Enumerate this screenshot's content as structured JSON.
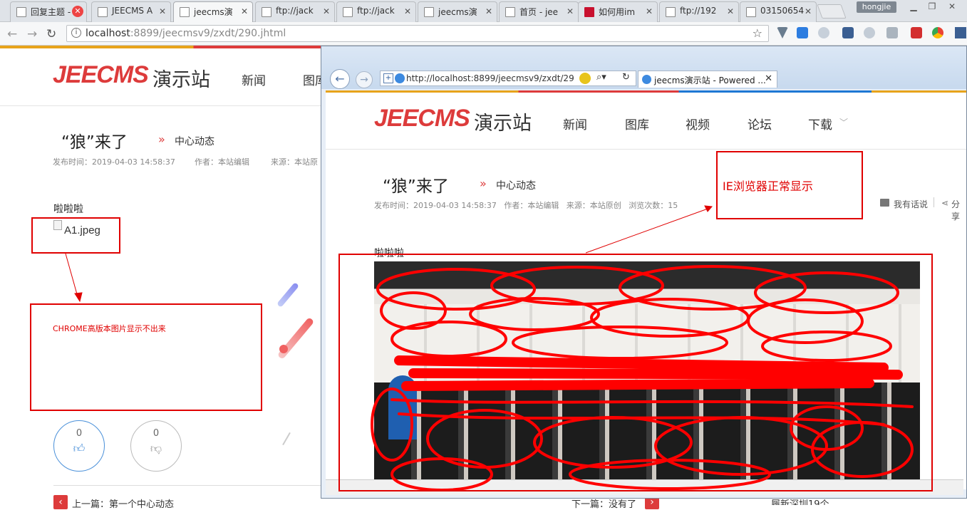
{
  "chrome": {
    "tabs": [
      {
        "title": "回复主题 -"
      },
      {
        "title": "JEECMS A"
      },
      {
        "title": "jeecms演"
      },
      {
        "title": "ftp://jack"
      },
      {
        "title": "ftp://jack"
      },
      {
        "title": "jeecms演"
      },
      {
        "title": "首页 - jee"
      },
      {
        "title": "如何用im"
      },
      {
        "title": "ftp://192"
      },
      {
        "title": "03150654"
      }
    ],
    "user": "hongjie",
    "url_host": "localhost",
    "url_rest": ":8899/jeecmsv9/zxdt/290.jhtml"
  },
  "site": {
    "logo_en": "JEECMS",
    "logo_cn": "演示站",
    "menu": [
      "新闻",
      "图库",
      "视频",
      "论坛",
      "下载"
    ]
  },
  "article": {
    "title": "“狼”来了",
    "category": "中心动态",
    "meta_time": "发布时间：2019-04-03 14:58:37",
    "meta_author": "作者：本站编辑",
    "meta_source_short": "来源：本站原",
    "meta_full": "发布时间：2019-04-03 14:58:37   作者：本站编辑   来源：本站原创   浏览次数：15",
    "body_text": "啦啦啦",
    "broken_image_alt": "A1.jpeg",
    "likes": "0",
    "dislikes": "0",
    "prev": "上一篇：第一个中心动态",
    "next": "下一篇：没有了",
    "comment": "我有话说",
    "share": "分享",
    "cut_bottom_text": "履新深圳19个"
  },
  "annotations": {
    "chrome_note": "CHROME高版本图片显示不出来",
    "ie_note": "IE浏览器正常显示"
  },
  "ie": {
    "url": "http://localhost:8899/jeecmsv9/zxdt/29",
    "tab_title": "jeecms演示站 - Powered ..."
  }
}
